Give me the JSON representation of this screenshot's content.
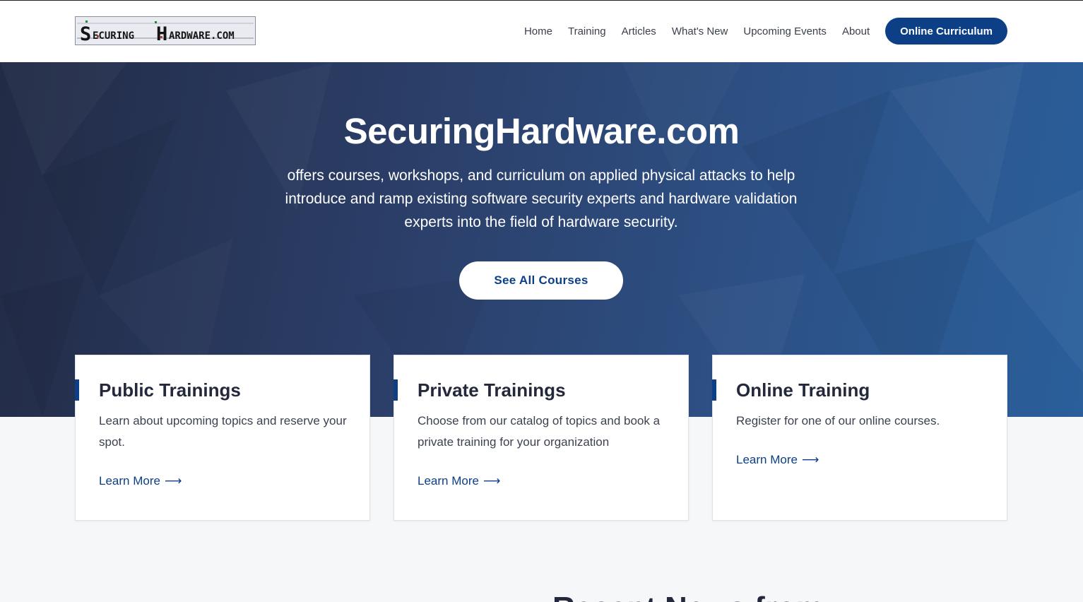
{
  "header": {
    "logo_text": "SECURING HARDWARE.COM",
    "nav": [
      "Home",
      "Training",
      "Articles",
      "What's New",
      "Upcoming Events",
      "About"
    ],
    "cta_label": "Online Curriculum"
  },
  "hero": {
    "title": "SecuringHardware.com",
    "subtitle": "offers courses, workshops, and curriculum on applied physical attacks to help introduce and ramp existing software security experts and hardware validation experts into the field of hardware security.",
    "button_label": "See All Courses"
  },
  "cards": [
    {
      "title": "Public Trainings",
      "text": "Learn about upcoming topics and reserve your spot.",
      "link": "Learn More"
    },
    {
      "title": "Private Trainings",
      "text": "Choose from our catalog of topics and book a private training for your organization",
      "link": "Learn More"
    },
    {
      "title": "Online Training",
      "text": "Register for one of our online courses.",
      "link": "Learn More"
    }
  ],
  "section_heading_peek": "Recent News from",
  "icons": {
    "link_arrow": "arrow-right-icon"
  },
  "colors": {
    "brand": "#0c3f86",
    "hero_dark": "#222b45",
    "hero_light": "#2a5f9b"
  }
}
